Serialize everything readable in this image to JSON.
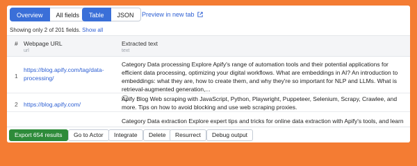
{
  "tabs_view": [
    {
      "label": "Overview",
      "active": true
    },
    {
      "label": "All fields",
      "active": false
    }
  ],
  "tabs_format": [
    {
      "label": "Table",
      "active": true
    },
    {
      "label": "JSON",
      "active": false
    }
  ],
  "preview_label": "Preview in new tab",
  "preview_icon": "external-link-icon",
  "showing_text": "Showing only 2 of 201 fields.",
  "show_all_label": "Show all",
  "columns": [
    {
      "label": "#",
      "sub": ""
    },
    {
      "label": "Webpage URL",
      "sub": "url"
    },
    {
      "label": "Extracted text",
      "sub": "text"
    }
  ],
  "rows": [
    {
      "index": "1",
      "url": "https://blog.apify.com/tag/data-processing/",
      "text": "Category Data processing Explore Apify's range of automation tools and their potential applications for efficient data processing, optimizing your digital workflows. What are embeddings in AI? An introduction to embeddings: what they are, how to create them, and why they're so important for NLP and LLMs. What is retrieval-augmented generation,..."
    },
    {
      "index": "2",
      "url": "https://blog.apify.com/",
      "text": "Apify Blog Web scraping with JavaScript, Python, Playwright, Puppeteer, Selenium, Scrapy, Crawlee, and more. Tips on how to avoid blocking and use web scraping proxies."
    },
    {
      "index": "",
      "url": "",
      "text": "Category Data extraction Explore expert tips and tricks for online data extraction with Apify's tools, and learn how to"
    }
  ],
  "footer_buttons": [
    "Export 654 results",
    "Go to Actor",
    "Integrate",
    "Delete",
    "Resurrect",
    "Debug output"
  ],
  "colors": {
    "background": "#f47c33",
    "accent": "#3a6fd8",
    "export_green": "#2e8b3a",
    "link": "#2d5fd3"
  }
}
